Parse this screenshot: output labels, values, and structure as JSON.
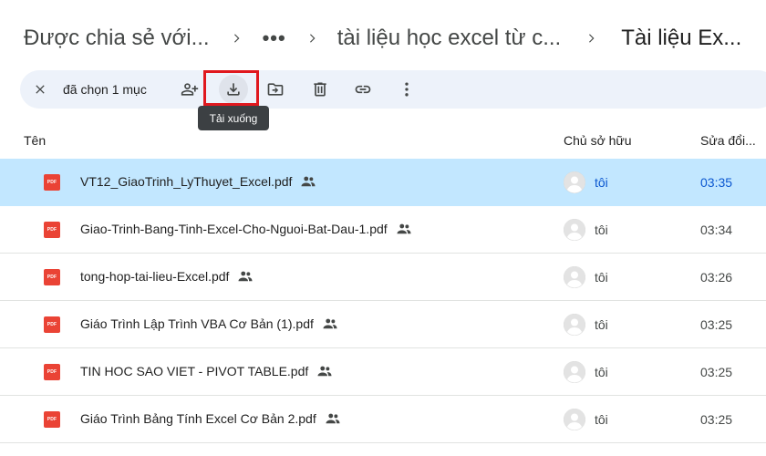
{
  "breadcrumb": {
    "items": [
      {
        "label": "Được chia sẻ với..."
      },
      {
        "label": "•••"
      },
      {
        "label": "tài liệu học excel từ c..."
      },
      {
        "label": "Tài liệu Ex..."
      }
    ]
  },
  "actionbar": {
    "selection_label": "đã chọn 1 mục",
    "buttons": [
      {
        "icon": "add-person-icon"
      },
      {
        "icon": "download-icon"
      },
      {
        "icon": "move-to-folder-icon"
      },
      {
        "icon": "trash-icon"
      },
      {
        "icon": "link-icon"
      },
      {
        "icon": "more-vert-icon"
      }
    ]
  },
  "tooltip": {
    "text": "Tải xuống"
  },
  "columns": {
    "name": "Tên",
    "owner": "Chủ sở hữu",
    "modified": "Sửa đổi..."
  },
  "files": [
    {
      "name": "VT12_GiaoTrinh_LyThuyet_Excel.pdf",
      "owner": "tôi",
      "modified": "03:35",
      "selected": true
    },
    {
      "name": "Giao-Trinh-Bang-Tinh-Excel-Cho-Nguoi-Bat-Dau-1.pdf",
      "owner": "tôi",
      "modified": "03:34",
      "selected": false
    },
    {
      "name": "tong-hop-tai-lieu-Excel.pdf",
      "owner": "tôi",
      "modified": "03:26",
      "selected": false
    },
    {
      "name": "Giáo Trình Lập Trình VBA Cơ Bản (1).pdf",
      "owner": "tôi",
      "modified": "03:25",
      "selected": false
    },
    {
      "name": "TIN HOC SAO VIET - PIVOT TABLE.pdf",
      "owner": "tôi",
      "modified": "03:25",
      "selected": false
    },
    {
      "name": "Giáo Trình Bảng Tính Excel Cơ Bản 2.pdf",
      "owner": "tôi",
      "modified": "03:25",
      "selected": false
    }
  ],
  "file_type_badge": "PDF",
  "colors": {
    "selected_row": "#c2e7ff",
    "action_bar": "#edf2fa",
    "pdf_red": "#ea4335",
    "highlight_red": "#e0181e",
    "accent_blue": "#0b57d0"
  }
}
